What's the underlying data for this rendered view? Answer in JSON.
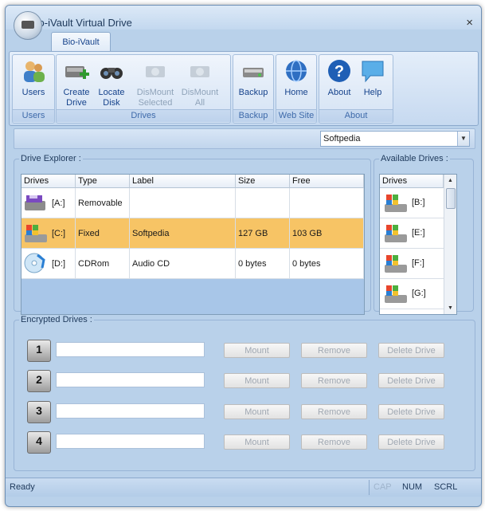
{
  "window": {
    "title": "Bio-iVault Virtual Drive",
    "close_glyph": "×"
  },
  "ribbon": {
    "tab": "Bio-iVault",
    "groups": [
      {
        "label": "Users",
        "buttons": [
          {
            "label": "Users",
            "icon": "users-icon"
          }
        ]
      },
      {
        "label": "Drives",
        "buttons": [
          {
            "label": "Create Drive",
            "icon": "create-drive-icon"
          },
          {
            "label": "Locate Disk",
            "icon": "binoculars-icon"
          },
          {
            "label": "DisMount Selected",
            "icon": "dismount-selected-icon",
            "disabled": true
          },
          {
            "label": "DisMount All",
            "icon": "dismount-all-icon",
            "disabled": true
          }
        ]
      },
      {
        "label": "Backup",
        "buttons": [
          {
            "label": "Backup",
            "icon": "backup-icon"
          }
        ]
      },
      {
        "label": "Web Site",
        "buttons": [
          {
            "label": "Home",
            "icon": "globe-icon"
          }
        ]
      },
      {
        "label": "About",
        "buttons": [
          {
            "label": "About",
            "icon": "help-icon"
          },
          {
            "label": "Help",
            "icon": "speech-bubble-icon"
          }
        ]
      }
    ]
  },
  "user_select": {
    "value": "Softpedia"
  },
  "drive_explorer": {
    "legend": "Drive Explorer :",
    "columns": [
      "Drives",
      "Type",
      "Label",
      "Size",
      "Free"
    ],
    "rows": [
      {
        "drive": "[A:]",
        "type": "Removable",
        "label": "",
        "size": "",
        "free": "",
        "icon": "floppy-drive-icon"
      },
      {
        "drive": "[C:]",
        "type": "Fixed",
        "label": "Softpedia",
        "size": "127 GB",
        "free": "103 GB",
        "icon": "windows-drive-icon",
        "selected": true
      },
      {
        "drive": "[D:]",
        "type": "CDRom",
        "label": "Audio CD",
        "size": "0 bytes",
        "free": "0 bytes",
        "icon": "cd-drive-icon"
      }
    ]
  },
  "available_drives": {
    "legend": "Available Drives :",
    "column": "Drives",
    "items": [
      "[B:]",
      "[E:]",
      "[F:]",
      "[G:]"
    ]
  },
  "encrypted_drives": {
    "legend": "Encrypted Drives :",
    "slots": [
      {
        "number": "1",
        "mount": "Mount",
        "remove": "Remove",
        "delete": "Delete Drive"
      },
      {
        "number": "2",
        "mount": "Mount",
        "remove": "Remove",
        "delete": "Delete Drive"
      },
      {
        "number": "3",
        "mount": "Mount",
        "remove": "Remove",
        "delete": "Delete Drive"
      },
      {
        "number": "4",
        "mount": "Mount",
        "remove": "Remove",
        "delete": "Delete Drive"
      }
    ]
  },
  "status": {
    "text": "Ready",
    "cap": "CAP",
    "num": "NUM",
    "scrl": "SCRL"
  },
  "colors": {
    "selected_row": "#f7c465",
    "ribbon_text": "#15428b",
    "window_bg": "#b9d1ea"
  }
}
